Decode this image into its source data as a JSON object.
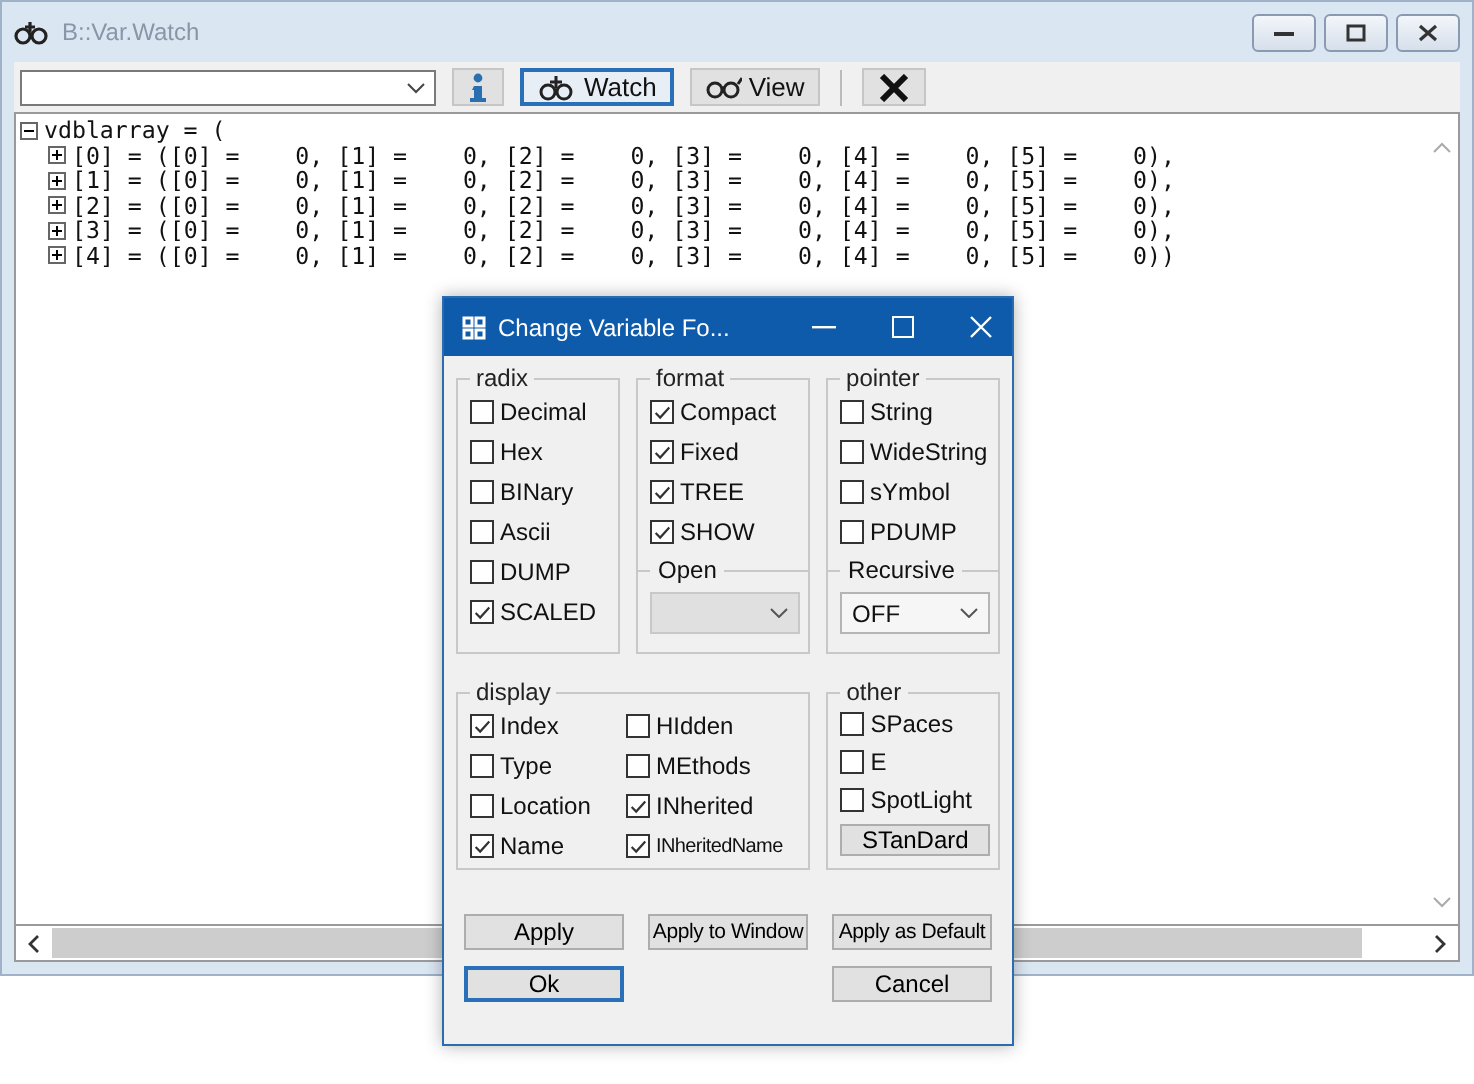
{
  "window": {
    "title": "B::Var.Watch"
  },
  "toolbar": {
    "buttons": [
      {
        "kind": "info",
        "selected": false
      },
      {
        "kind": "watch",
        "label": "Watch",
        "selected": true
      },
      {
        "kind": "view",
        "label": "View",
        "selected": false
      },
      {
        "kind": "clear",
        "selected": false
      }
    ]
  },
  "tree": {
    "text": "vdblarray = (",
    "expanded": true,
    "children": [
      {
        "text": "[0] = ([0] =    0, [1] =    0, [2] =    0, [3] =    0, [4] =    0, [5] =    0),",
        "expanded": false
      },
      {
        "text": "[1] = ([0] =    0, [1] =    0, [2] =    0, [3] =    0, [4] =    0, [5] =    0),",
        "expanded": false
      },
      {
        "text": "[2] = ([0] =    0, [1] =    0, [2] =    0, [3] =    0, [4] =    0, [5] =    0),",
        "expanded": false
      },
      {
        "text": "[3] = ([0] =    0, [1] =    0, [2] =    0, [3] =    0, [4] =    0, [5] =    0),",
        "expanded": false
      },
      {
        "text": "[4] = ([0] =    0, [1] =    0, [2] =    0, [3] =    0, [4] =    0, [5] =    0))",
        "expanded": false
      }
    ]
  },
  "dialog": {
    "title": "Change Variable Fo...",
    "top_groups": [
      {
        "title": "radix",
        "checkboxes": [
          {
            "label": "Decimal",
            "checked": false
          },
          {
            "label": "Hex",
            "checked": false
          },
          {
            "label": "BINary",
            "checked": false
          },
          {
            "label": "Ascii",
            "checked": false
          },
          {
            "label": "DUMP",
            "checked": false
          },
          {
            "label": "SCALED",
            "checked": true
          }
        ]
      },
      {
        "title": "format",
        "checkboxes": [
          {
            "label": "Compact",
            "checked": true
          },
          {
            "label": "Fixed",
            "checked": true
          },
          {
            "label": "TREE",
            "checked": true
          },
          {
            "label": "SHOW",
            "checked": true
          }
        ],
        "dropdown": {
          "label": "Open",
          "disabled": true
        }
      },
      {
        "title": "pointer",
        "checkboxes": [
          {
            "label": "String",
            "checked": false
          },
          {
            "label": "WideString",
            "checked": false
          },
          {
            "label": "sYmbol",
            "checked": false
          },
          {
            "label": "PDUMP",
            "checked": false
          }
        ],
        "dropdown": {
          "label": "Recursive",
          "value": "OFF",
          "disabled": false
        }
      }
    ],
    "display": {
      "title": "display",
      "checkboxes": [
        {
          "label": "Index",
          "checked": true
        },
        {
          "label": "HIdden",
          "checked": false
        },
        {
          "label": "Type",
          "checked": false
        },
        {
          "label": "MEthods",
          "checked": false
        },
        {
          "label": "Location",
          "checked": false
        },
        {
          "label": "INherited",
          "checked": true
        },
        {
          "label": "Name",
          "checked": true
        },
        {
          "label": "INheritedName",
          "checked": true
        }
      ]
    },
    "other": {
      "title": "other",
      "checkboxes": [
        {
          "label": "SPaces",
          "checked": false
        },
        {
          "label": "E",
          "checked": false
        },
        {
          "label": "SpotLight",
          "checked": false
        }
      ],
      "button": "STanDard"
    },
    "buttons": [
      {
        "label": "Apply",
        "selected": false
      },
      {
        "label": "Apply to Window",
        "selected": false
      },
      {
        "label": "Apply as Default",
        "selected": false
      },
      {
        "label": "Ok",
        "selected": true
      },
      {
        "label": "Cancel",
        "selected": false
      }
    ]
  }
}
